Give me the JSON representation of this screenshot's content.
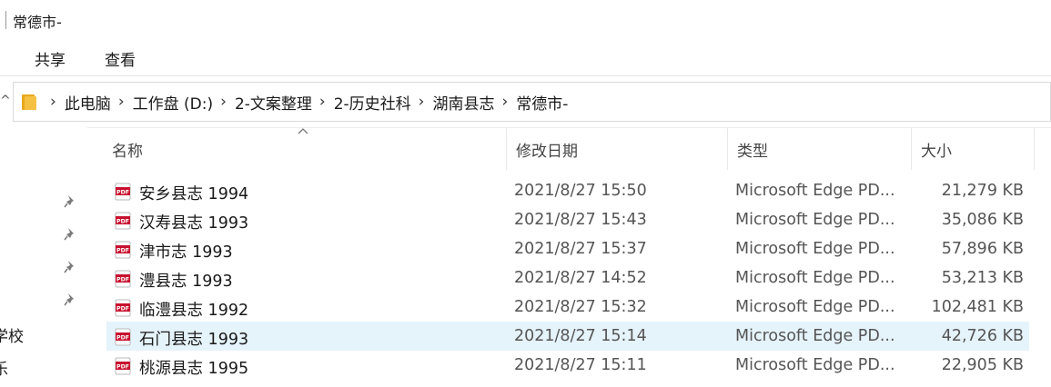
{
  "window": {
    "title": "常德市-"
  },
  "ribbon": {
    "tabs": [
      "共享",
      "查看"
    ]
  },
  "address": {
    "crumbs": [
      "此电脑",
      "工作盘 (D:)",
      "2-文案整理",
      "2-历史社科",
      "湖南县志",
      "常德市-"
    ]
  },
  "nav": {
    "items": [
      "学校",
      "乐"
    ]
  },
  "columns": {
    "name": "名称",
    "date": "修改日期",
    "type": "类型",
    "size": "大小"
  },
  "files": [
    {
      "name": "安乡县志 1994",
      "date": "2021/8/27 15:50",
      "type": "Microsoft Edge PD...",
      "size": "21,279 KB"
    },
    {
      "name": "汉寿县志 1993",
      "date": "2021/8/27 15:43",
      "type": "Microsoft Edge PD...",
      "size": "35,086 KB"
    },
    {
      "name": "津市志 1993",
      "date": "2021/8/27 15:37",
      "type": "Microsoft Edge PD...",
      "size": "57,896 KB"
    },
    {
      "name": "澧县志 1993",
      "date": "2021/8/27 14:52",
      "type": "Microsoft Edge PD...",
      "size": "53,213 KB"
    },
    {
      "name": "临澧县志 1992",
      "date": "2021/8/27 15:32",
      "type": "Microsoft Edge PD...",
      "size": "102,481 KB"
    },
    {
      "name": "石门县志 1993",
      "date": "2021/8/27 15:14",
      "type": "Microsoft Edge PD...",
      "size": "42,726 KB"
    },
    {
      "name": "桃源县志 1995",
      "date": "2021/8/27 15:11",
      "type": "Microsoft Edge PD...",
      "size": "22,905 KB"
    }
  ],
  "selected_index": 5,
  "colors": {
    "selection": "#e5f3fb",
    "pdf_icon": "#c8102e",
    "folder": "#f5c143"
  }
}
